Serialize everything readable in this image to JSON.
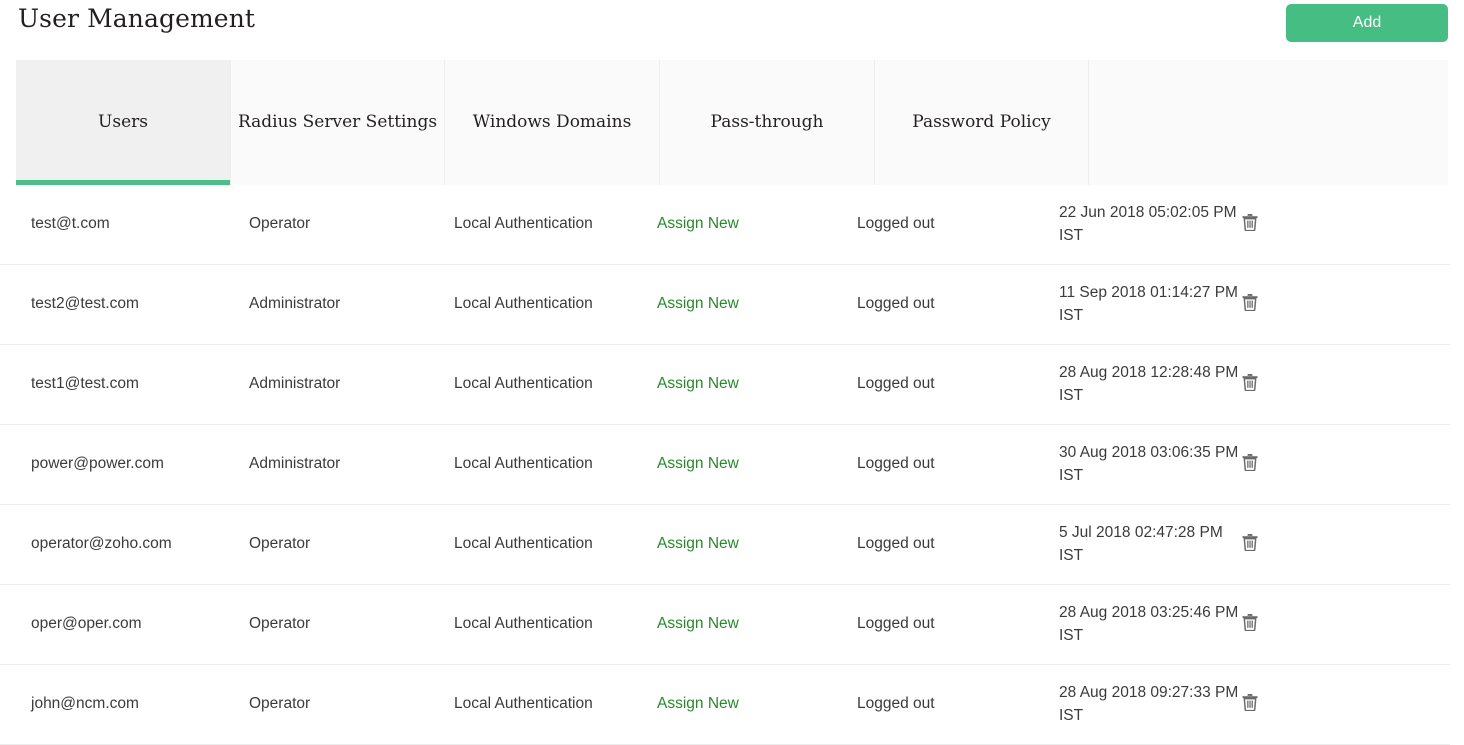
{
  "header": {
    "title": "User Management",
    "add_label": "Add"
  },
  "tabs": [
    {
      "label": "Users",
      "active": true
    },
    {
      "label": "Radius Server Settings",
      "active": false
    },
    {
      "label": "Windows Domains",
      "active": false
    },
    {
      "label": "Pass-through",
      "active": false
    },
    {
      "label": "Password Policy",
      "active": false
    }
  ],
  "table": {
    "assign_label": "Assign New",
    "delete_icon": "trash-icon",
    "rows": [
      {
        "user": "test@t.com",
        "role": "Operator",
        "auth": "Local Authentication",
        "assign": "Assign New",
        "status": "Logged out",
        "date": "22 Jun 2018 05:02:05 PM IST"
      },
      {
        "user": "test2@test.com",
        "role": "Administrator",
        "auth": "Local Authentication",
        "assign": "Assign New",
        "status": "Logged out",
        "date": "11 Sep 2018 01:14:27 PM IST"
      },
      {
        "user": "test1@test.com",
        "role": "Administrator",
        "auth": "Local Authentication",
        "assign": "Assign New",
        "status": "Logged out",
        "date": "28 Aug 2018 12:28:48 PM IST"
      },
      {
        "user": "power@power.com",
        "role": "Administrator",
        "auth": "Local Authentication",
        "assign": "Assign New",
        "status": "Logged out",
        "date": "30 Aug 2018 03:06:35 PM IST"
      },
      {
        "user": "operator@zoho.com",
        "role": "Operator",
        "auth": "Local Authentication",
        "assign": "Assign New",
        "status": "Logged out",
        "date": "5 Jul 2018 02:47:28 PM IST"
      },
      {
        "user": "oper@oper.com",
        "role": "Operator",
        "auth": "Local Authentication",
        "assign": "Assign New",
        "status": "Logged out",
        "date": "28 Aug 2018 03:25:46 PM IST"
      },
      {
        "user": "john@ncm.com",
        "role": "Operator",
        "auth": "Local Authentication",
        "assign": "Assign New",
        "status": "Logged out",
        "date": "28 Aug 2018 09:27:33 PM IST"
      }
    ]
  },
  "colors": {
    "button_green": "#46bd83",
    "link_green": "#27892c",
    "tab_underline": "#4ebd87",
    "text": "#3b3b3b"
  }
}
